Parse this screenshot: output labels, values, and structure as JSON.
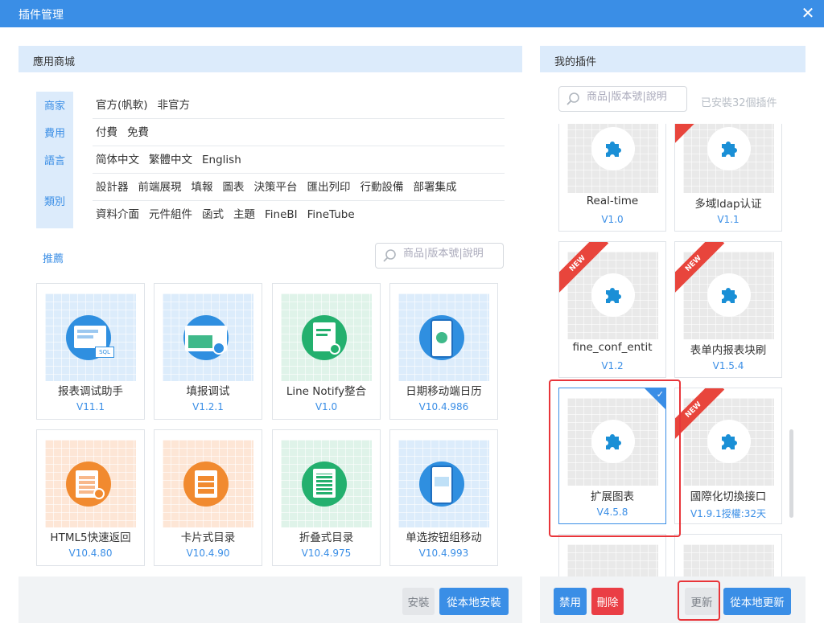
{
  "window": {
    "title": "插件管理",
    "close_icon": "close-icon"
  },
  "left_panel": {
    "header": "應用商城",
    "filters": [
      {
        "label": "商家",
        "options": [
          "官方(帆軟)",
          "非官方"
        ]
      },
      {
        "label": "費用",
        "options": [
          "付費",
          "免費"
        ]
      },
      {
        "label": "語言",
        "options": [
          "简体中文",
          "繁體中文",
          "English"
        ]
      },
      {
        "label": "類別",
        "rows": [
          [
            "設計器",
            "前端展現",
            "填報",
            "圖表",
            "決策平台",
            "匯出列印",
            "行動設備",
            "部署集成"
          ],
          [
            "資料介面",
            "元件組件",
            "函式",
            "主題",
            "FineBI",
            "FineTube"
          ]
        ]
      }
    ],
    "recommend_title": "推薦",
    "search_placeholder": "商品|版本號|說明",
    "cards": [
      {
        "name": "报表调试助手",
        "version": "V11.1",
        "theme": "blue"
      },
      {
        "name": "填报调试",
        "version": "V1.2.1",
        "theme": "blue"
      },
      {
        "name": "Line Notify整合",
        "version": "V1.0",
        "theme": "green"
      },
      {
        "name": "日期移动端日历",
        "version": "V10.4.986",
        "theme": "blue"
      },
      {
        "name": "HTML5快速返回",
        "version": "V10.4.80",
        "theme": "orange"
      },
      {
        "name": "卡片式目录",
        "version": "V10.4.90",
        "theme": "orange"
      },
      {
        "name": "折叠式目录",
        "version": "V10.4.975",
        "theme": "green"
      },
      {
        "name": "单选按钮组移动",
        "version": "V10.4.993",
        "theme": "blue"
      }
    ],
    "footer": {
      "install": "安裝",
      "install_local": "從本地安裝"
    }
  },
  "right_panel": {
    "header": "我的插件",
    "search_placeholder": "商品|版本號|說明",
    "installed_count": "已安裝32個插件",
    "cards": [
      {
        "name": "Real-time",
        "version": "V1.0",
        "badge": ""
      },
      {
        "name": "多域ldap认证",
        "version": "V1.1",
        "badge": "new"
      },
      {
        "name": "fine_conf_entit",
        "version": "V1.2",
        "badge": "NEW"
      },
      {
        "name": "表单内报表块刷",
        "version": "V1.5.4",
        "badge": "NEW"
      },
      {
        "name": "扩展图表",
        "version": "V4.5.8",
        "badge": "selected"
      },
      {
        "name": "國際化切換接口",
        "version": "V1.9.1",
        "extra": "授權:32天",
        "badge": "NEW"
      }
    ],
    "footer": {
      "disable": "禁用",
      "delete": "刪除",
      "update": "更新",
      "update_local": "從本地更新"
    }
  },
  "colors": {
    "accent": "#3a8ee6",
    "danger": "#ea3e45",
    "header_bg": "#dcebfb"
  }
}
